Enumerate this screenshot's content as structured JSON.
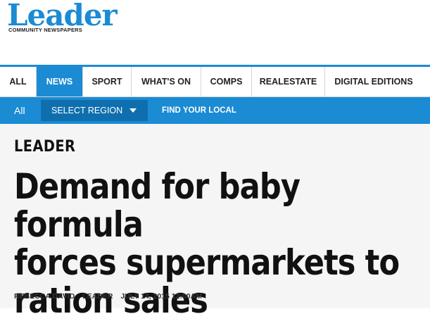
{
  "brand": {
    "logo_text": "Leader",
    "tagline": "COMMUNITY NEWSPAPERS"
  },
  "nav": {
    "items": [
      {
        "label": "ALL"
      },
      {
        "label": "NEWS"
      },
      {
        "label": "SPORT"
      },
      {
        "label": "WHAT'S ON"
      },
      {
        "label": "COMPS"
      },
      {
        "label": "REALESTATE"
      },
      {
        "label": "DIGITAL EDITIONS"
      }
    ],
    "active": "NEWS"
  },
  "subnav": {
    "all_label": "All",
    "select_region_label": "SELECT REGION",
    "find_local_label": "FIND YOUR LOCAL"
  },
  "article": {
    "section": "LEADER",
    "headline_lines": [
      "Demand for baby formula",
      "forces supermarkets to",
      "ration sales"
    ],
    "author": "REBECCA DAVID",
    "publication": "LEADER",
    "date": "JULY 14, 2015 12:00AM"
  },
  "colors": {
    "brand_blue": "#1b8bd4",
    "dropdown_blue": "#0f6fae",
    "article_bg": "#f5f5f5"
  }
}
